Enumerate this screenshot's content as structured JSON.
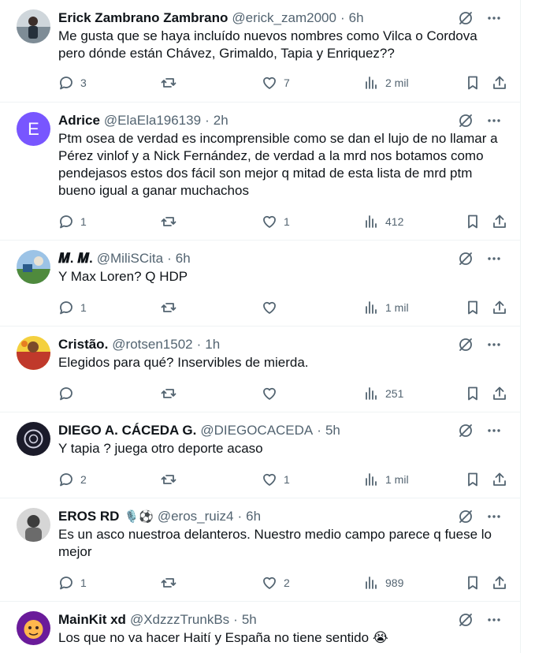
{
  "tweets": [
    {
      "name": "Erick Zambrano Zambrano",
      "handle": "@erick_zam2000",
      "time": "6h",
      "avatar": {
        "type": "photo",
        "colors": [
          "#6b7a86",
          "#2e3a46"
        ]
      },
      "text": "Me gusta que se haya incluído nuevos nombres como Vilca o Cordova pero dónde están Chávez, Grimaldo, Tapia y Enriquez??",
      "replies": "3",
      "likes": "7",
      "views": "2 mil"
    },
    {
      "name": "Adrice",
      "handle": "@ElaEla196139",
      "time": "2h",
      "avatar": {
        "type": "letter",
        "letter": "E",
        "colors": [
          "#7856ff"
        ]
      },
      "text": "Ptm osea de verdad es incomprensible como se dan el lujo de no llamar a Pérez vinlof y a Nick Fernández, de verdad a la mrd nos botamos como pendejasos estos dos fácil son mejor q mitad de esta lista de mrd ptm bueno igual a ganar muchachos",
      "replies": "1",
      "likes": "1",
      "views": "412"
    },
    {
      "name": "𝑴. 𝑴.",
      "handle": "@MiliSCita",
      "time": "6h",
      "avatar": {
        "type": "photo",
        "colors": [
          "#8fb6d8",
          "#4a7a3c"
        ]
      },
      "text": "Y Max Loren? Q HDP",
      "replies": "1",
      "likes": "",
      "views": "1 mil"
    },
    {
      "name": "Cristão.",
      "handle": "@rotsen1502",
      "time": "1h",
      "avatar": {
        "type": "photo",
        "colors": [
          "#c0392b",
          "#f1c40f"
        ]
      },
      "text": "Elegidos para qué? Inservibles de mierda.",
      "replies": "",
      "likes": "",
      "views": "251"
    },
    {
      "name": "DIEGO A. CÁCEDA G.",
      "handle": "@DIEGOCACEDA",
      "time": "5h",
      "avatar": {
        "type": "photo",
        "colors": [
          "#1b1b2a",
          "#c8c8d8"
        ]
      },
      "text": "Y tapia ? juega otro deporte acaso",
      "replies": "2",
      "likes": "1",
      "views": "1 mil"
    },
    {
      "name": "EROS RD",
      "name_emojis": "🎙️⚽",
      "handle": "@eros_ruiz4",
      "time": "6h",
      "avatar": {
        "type": "photo",
        "colors": [
          "#d9d9d9",
          "#5a5a5a"
        ]
      },
      "text": "Es un asco nuestroa delanteros. Nuestro medio campo parece q fuese lo mejor",
      "replies": "1",
      "likes": "2",
      "views": "989"
    },
    {
      "name": "MainKit xd",
      "handle": "@XdzzzTrunkBs",
      "time": "5h",
      "avatar": {
        "type": "photo",
        "colors": [
          "#6a1b9a",
          "#ffb74d"
        ]
      },
      "text": "Los que no va hacer Haití y España no tiene sentido 😭",
      "replies": "",
      "likes": "",
      "views": ""
    }
  ],
  "separator": "·"
}
